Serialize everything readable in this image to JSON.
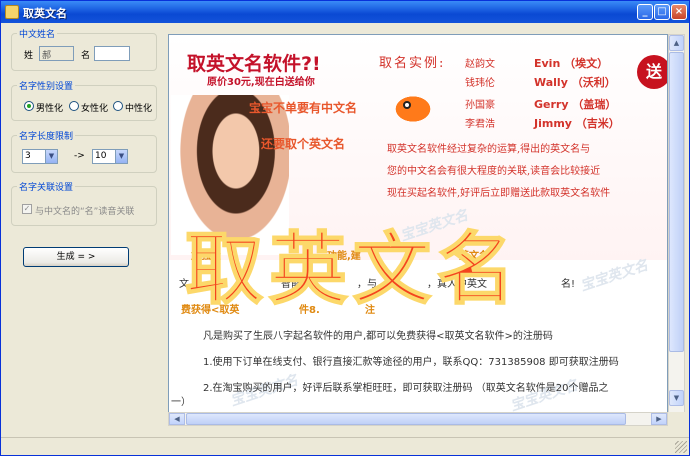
{
  "window": {
    "title": "取英文名"
  },
  "groups": {
    "chinese_name": {
      "title": "中文姓名",
      "surname_label": "姓",
      "surname_value": "郝",
      "given_label": "名",
      "given_value": ""
    },
    "gender": {
      "title": "名字性别设置",
      "options": [
        "男性化",
        "女性化",
        "中性化"
      ],
      "selected": "男性化"
    },
    "length": {
      "title": "名字长度限制",
      "min": "3",
      "separator": "->",
      "max": "10"
    },
    "relation": {
      "title": "名字关联设置",
      "checkbox_label": "与中文名的“名”读音关联"
    }
  },
  "generate_button": "生成 = >",
  "banner": {
    "title": "取英文名软件?!",
    "subtitle": "原价30元,现在白送给你",
    "line1": "宝宝不单要有中文名",
    "line2": "还要取个英文名",
    "examples_label": "取名实例:",
    "examples": [
      {
        "cn": "赵韵文",
        "en": "Evin （埃文）"
      },
      {
        "cn": "钱玮伦",
        "en": "Wally （沃利）"
      },
      {
        "cn": "孙国豪",
        "en": "Gerry （盖瑞）"
      },
      {
        "cn": "李君浩",
        "en": "Jimmy （吉米）"
      }
    ],
    "send_badge": "送",
    "desc": [
      "取英文名软件经过复杂的运算,得出的英文名与",
      "您的中文名会有很大程度的关联,读音会比较接近",
      "现在买起名软件,好评后立即赠送此款取英文名软件"
    ],
    "big_title": "取英文名"
  },
  "article": {
    "orange_line1_a": "加强大",
    "orange_line1_b": "功能,建",
    "orange_line1_c": "英文名",
    "line2_a": "文",
    "line2_b": "智能",
    "line2_c": "，与",
    "line2_d": "，真人中英文",
    "line2_e": "名!",
    "orange_line3_a": "费获得<取英",
    "orange_line3_b": "件8.",
    "orange_line3_c": "注",
    "para1": "凡是购买了生辰八字起名软件的用户,都可以免费获得<取英文名软件>的注册码",
    "para2": "1.使用下订单在线支付、银行直接汇款等途径的用户，联系QQ：731385908 即可获取注册码",
    "para3": "2.在淘宝购买的用户，好评后联系掌柜旺旺，即可获取注册码  （取英文名软件是20个赠品之",
    "para3_cont": "一）"
  },
  "watermark_text": "宝宝英文名"
}
